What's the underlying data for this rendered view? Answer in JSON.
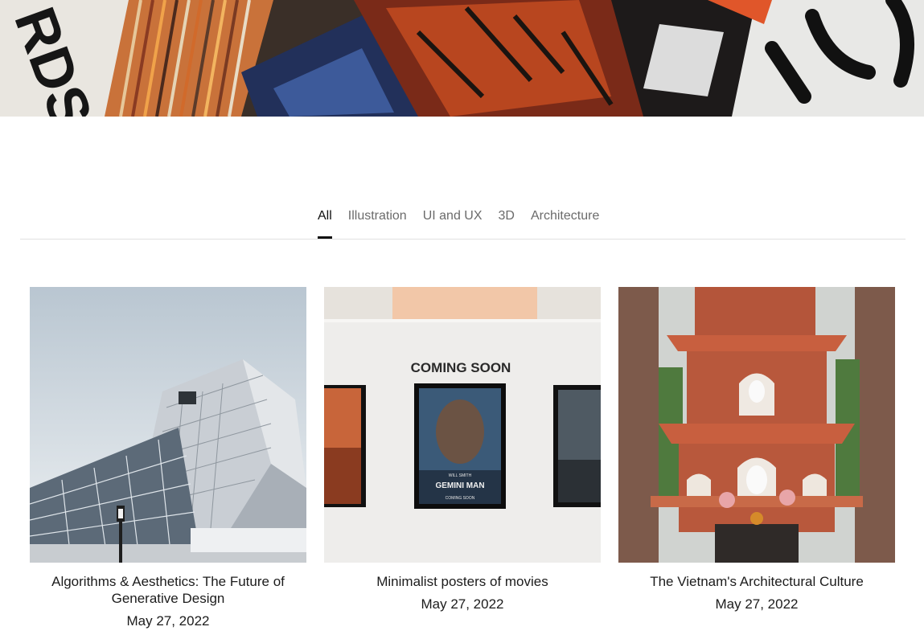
{
  "tabs": [
    {
      "label": "All",
      "active": true
    },
    {
      "label": "Illustration",
      "active": false
    },
    {
      "label": "UI and UX",
      "active": false
    },
    {
      "label": "3D",
      "active": false
    },
    {
      "label": "Architecture",
      "active": false
    }
  ],
  "posts": [
    {
      "title": "Algorithms & Aesthetics: The Future of Generative Design",
      "date": "May 27, 2022",
      "image": "modern-glass-building"
    },
    {
      "title": "Minimalist posters of movies",
      "date": "May 27, 2022",
      "image": "movie-posters-wall",
      "sign_text": "COMING SOON",
      "poster_text": "GEMINI MAN",
      "poster_subtext": "WILL SMITH",
      "poster_footer": "COMING SOON"
    },
    {
      "title": "The Vietnam's Architectural Culture",
      "date": "May 27, 2022",
      "image": "red-pagoda"
    }
  ],
  "hero": {
    "image": "abstract-painted-boards",
    "text_fragment": "RDS"
  }
}
